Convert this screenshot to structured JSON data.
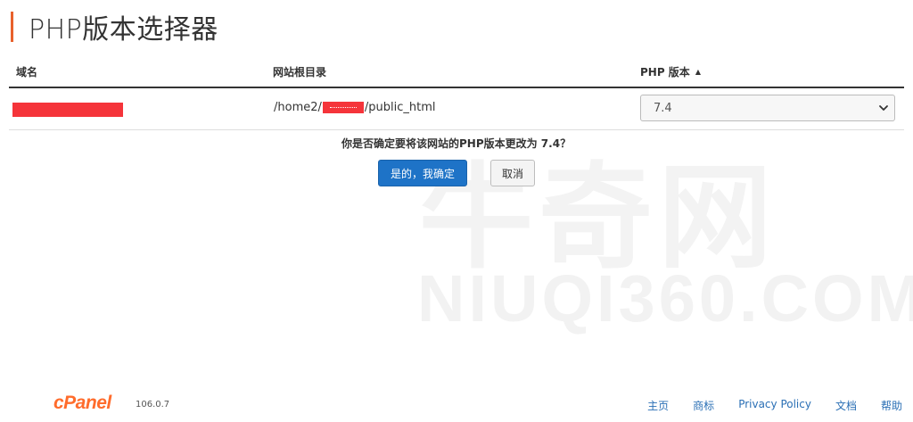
{
  "header": {
    "title": "PHP版本选择器",
    "accent_color": "#e8612c"
  },
  "table": {
    "columns": {
      "domain": "域名",
      "docroot": "网站根目录",
      "php": "PHP 版本"
    },
    "sort_indicator": "▲",
    "row": {
      "docroot_prefix": "/home2/",
      "docroot_suffix": "/public_html",
      "php_version": "7.4"
    }
  },
  "confirm": {
    "question": "你是否确定要将该网站的PHP版本更改为 7.4？",
    "confirm_label": "是的，我确定",
    "cancel_label": "取消",
    "confirm_color": "#1e73c7"
  },
  "watermark": {
    "chinese": "牛奇网",
    "latin": "NIUQI360.COM"
  },
  "footer": {
    "brand": "cPanel",
    "version": "106.0.7",
    "links": [
      "主页",
      "商标",
      "Privacy Policy",
      "文档",
      "帮助"
    ],
    "brand_color": "#ff6c2c",
    "link_color": "#2a6fb5"
  }
}
